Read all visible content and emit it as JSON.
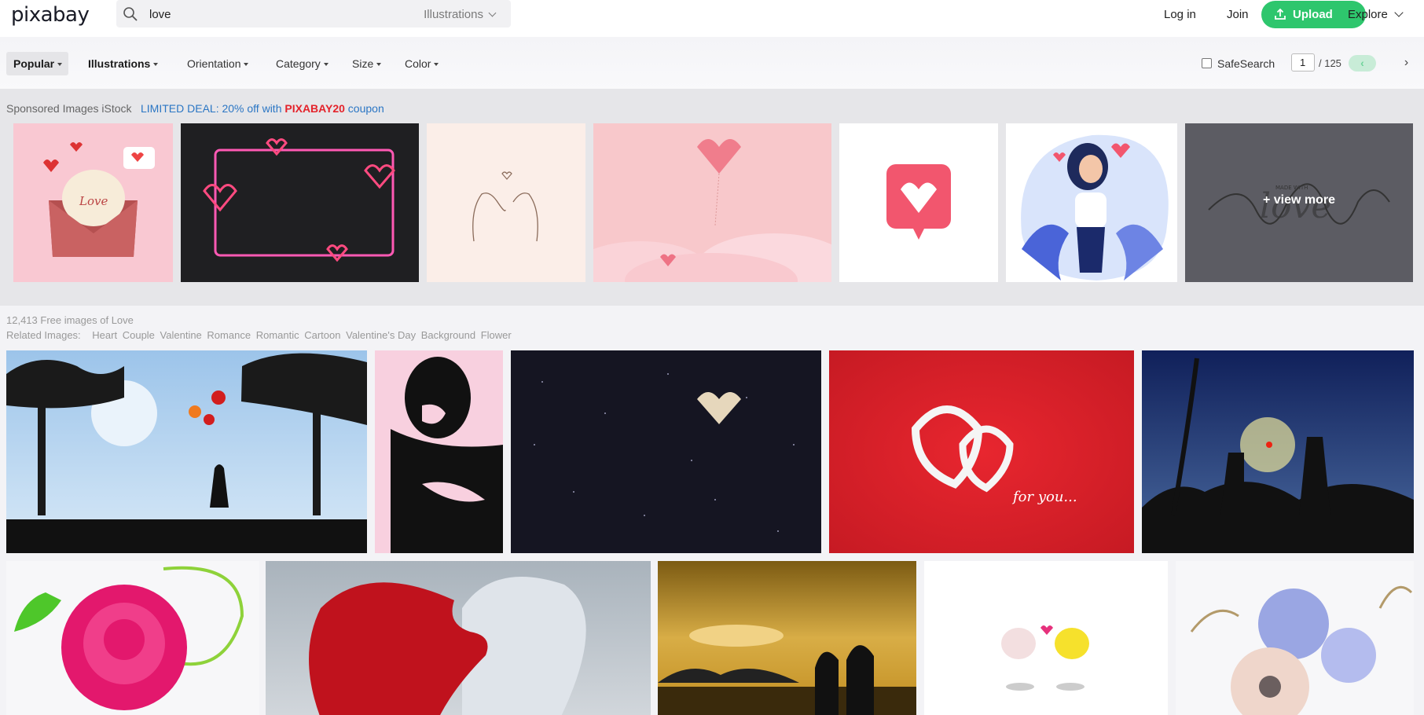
{
  "header": {
    "logo": "pixabay",
    "search_value": "love",
    "search_type": "Illustrations",
    "login": "Log in",
    "join": "Join",
    "upload": "Upload",
    "explore": "Explore"
  },
  "filters": {
    "popular": "Popular",
    "illustrations": "Illustrations",
    "orientation": "Orientation",
    "category": "Category",
    "size": "Size",
    "color": "Color",
    "safesearch": "SafeSearch",
    "page_current": "1",
    "page_total": "/ 125",
    "prev": "‹",
    "next": "›"
  },
  "sponsored": {
    "label": "Sponsored Images iStock",
    "deal_prefix": "LIMITED DEAL: 20% off with",
    "deal_code": "PIXABAY20",
    "deal_suffix": "coupon",
    "view_more": "+ view more",
    "envelope_script": "Love",
    "viewmore_script": "MADE WITH",
    "viewmore_script2": "love"
  },
  "results": {
    "count": "12,413 Free images of Love",
    "related_label": "Related Images:",
    "related_tags": [
      "Heart",
      "Couple",
      "Valentine",
      "Romance",
      "Romantic",
      "Cartoon",
      "Valentine's Day",
      "Background",
      "Flower"
    ],
    "card_text": "for you..."
  },
  "colors": {
    "upload_green": "#2ec66d",
    "deal_blue": "#2b76c4",
    "coupon_red": "#e4232b"
  }
}
